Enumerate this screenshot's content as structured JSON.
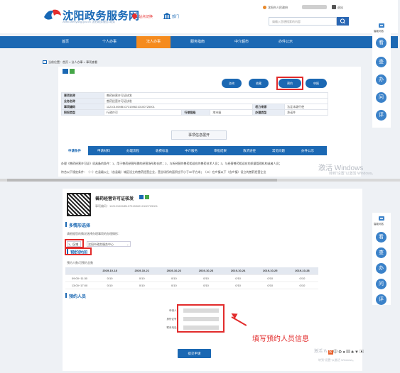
{
  "header": {
    "site_name": "沈阳政务服务网",
    "site_url": "zwfw.shenyang.gov.cn 沈阳政务服务 政务",
    "location": "站点切换",
    "institution": "部门",
    "login_text": "沈阳市人民政府",
    "logout_text": "退出",
    "search_placeholder": "请输入您想搜索的内容"
  },
  "nav": [
    "首页",
    "个人办事",
    "法人办事",
    "服务指南",
    "中介超市",
    "办件公示"
  ],
  "breadcrumb": "当前位置：首页 > 法人办事 > 事项查看",
  "actions": {
    "consult": "咨询",
    "favorite": "收藏",
    "booking": "预约",
    "apply": "申报"
  },
  "info_table": [
    [
      "事项名称",
      "兽药经营许可证核发",
      "",
      "",
      "",
      ""
    ],
    [
      "业务名称",
      "兽药经营许可证核发",
      "",
      "",
      "",
      ""
    ],
    [
      "事项编码",
      "11210100MB10731596210100725001",
      "",
      "",
      "权力来源",
      "法定本级行使"
    ],
    [
      "职权类型",
      "行政许可",
      "行使层级",
      "地市级",
      "办理类型",
      "承诺件"
    ]
  ],
  "expand_label": "事项信息展开",
  "tabs": [
    "申请条件",
    "申请材料",
    "办理流程",
    "收费标准",
    "中介服务",
    "审批结果",
    "救济途径",
    "常见问题",
    "办件公示"
  ],
  "desc_lines": [
    "办理《兽药经营许可证》须具备的条件：1、用于兽药经营所需的经营场所和仓库；2、与所经营的兽药相适应的兽药技术人员；3、与经营兽药相适应的质量管理机构或者人员；",
    "符合以下规定条件：（一）在县级以上（含县级）城区设立的兽药经营企业，营业场所的面积应不小于30平方米；（二）在乡镇以下（含乡镇）设立的兽药经营企业"
  ],
  "watermark": {
    "line1": "激活 Windows",
    "line2": "转到\"设置\"以激活 Windows。"
  },
  "sidebar_top_label": "智能问答",
  "sidebar_bot_label": "智能问答",
  "sidebar_icons": [
    "看",
    "查",
    "办",
    "问",
    "评"
  ],
  "booking": {
    "item_title": "兽药经营许可证核发",
    "item_code": "事项编码：11210100MB10731596210100725001",
    "section_scenario": "多情形选择",
    "scenario_hint": "请根据您的情况选择办理事项的办理情形：",
    "select_scenario": "1、区域",
    "select_center": "沈阳市政务服务中心",
    "section_time": "预约时间",
    "time_hint": "预约人数/可预约总数",
    "dates": [
      "2019-10-18",
      "2019-10-21",
      "2019-10-22",
      "2019-10-23",
      "2019-10-24",
      "2019-10-25",
      "2019-10-28"
    ],
    "slots": [
      {
        "time": "09:00~11:30",
        "counts": [
          "0/10",
          "0/10",
          "0/10",
          "0/10",
          "0/10",
          "0/10",
          "0/10"
        ]
      },
      {
        "time": "13:00~17:00",
        "counts": [
          "0/10",
          "0/10",
          "0/10",
          "0/10",
          "0/10",
          "0/10",
          "0/10"
        ]
      }
    ],
    "section_person": "预约人员",
    "person_labels": [
      "申请人：",
      "身份证号：",
      "联系电话："
    ],
    "annotation": "填写预约人员信息",
    "submit": "提交申请"
  },
  "colors": {
    "brand": "#1b68b3",
    "active": "#f58b1e",
    "highlight": "#e22b2b"
  }
}
